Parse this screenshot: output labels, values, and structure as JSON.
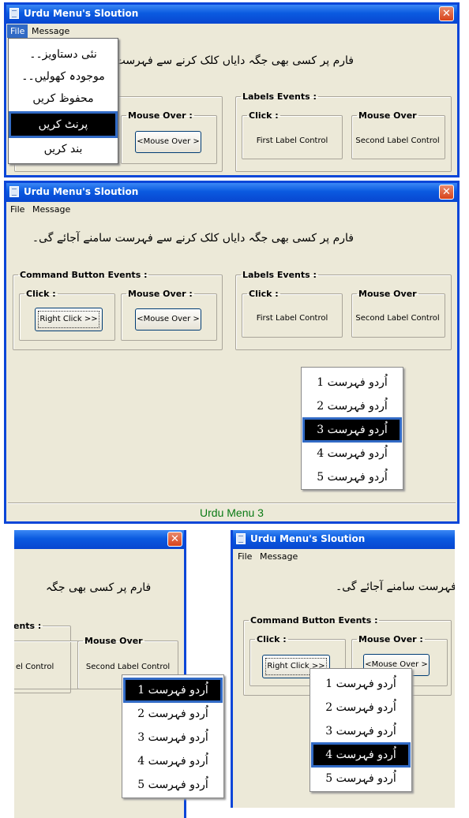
{
  "window": {
    "title": "Urdu Menu's Sloution",
    "close_glyph": "✕"
  },
  "menu": {
    "file": "File",
    "message": "Message"
  },
  "instruction": "فارم پر کسی بھی جگہ دایاں کلک کرنے سے فہرست سامنے آجائے گی۔",
  "command_events": {
    "legend": "Command Button Events :",
    "click_legend": "Click :",
    "mouseover_legend": "Mouse Over  :",
    "right_click_button": "Right Click >>",
    "mouse_over_button": "<Mouse Over >"
  },
  "label_events": {
    "legend": "Labels Events :",
    "click_legend": "Click :",
    "mouseover_legend": "Mouse Over",
    "first_label": "First Label Control",
    "second_label": "Second Label Control"
  },
  "file_menu_items": [
    "نئی دستاویز۔۔",
    "موجودہ کھولیں۔۔",
    "محفوظ کریں",
    "پرنٹ کریں",
    "بند کریں"
  ],
  "popup_items": [
    "اُردو فہرست 1",
    "اُردو فہرست 2",
    "اُردو فہرست 3",
    "اُردو فہرست 4",
    "اُردو فہرست 5"
  ],
  "status_text": "Urdu Menu 3",
  "partial": {
    "instruction_left": "فارم پر کسی بھی جگہ",
    "instruction_right": "سے فہرست سامنے آجائے گی۔",
    "events_fragment": "ents :",
    "label_fragment": "el Control"
  }
}
